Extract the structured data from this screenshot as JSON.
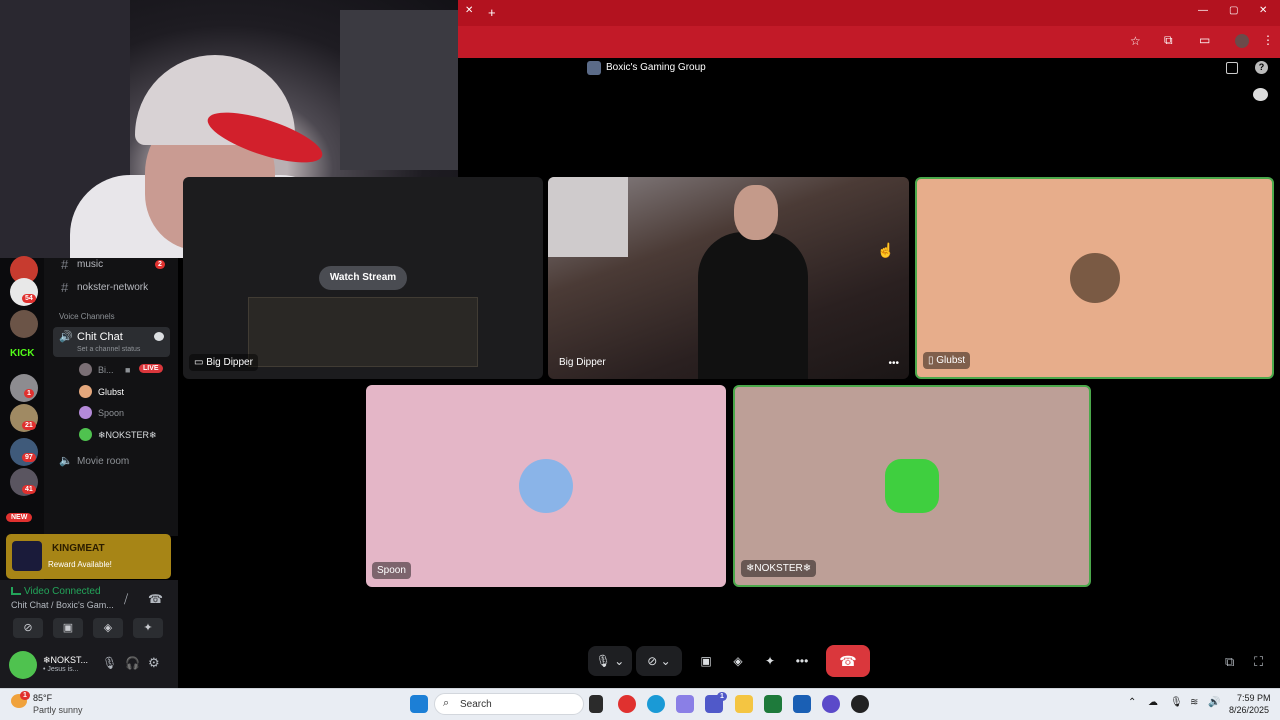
{
  "browser": {
    "new_tab_glyph": "+",
    "close_tab_glyph": "✕",
    "window_controls": [
      "—",
      "▢",
      "✕"
    ]
  },
  "discord": {
    "server_title": "Boxic's Gaming Group",
    "channels": {
      "music_label": "music",
      "music_badge": "2",
      "nokster_label": "nokster-network",
      "voice_header": "Voice Channels",
      "chit_chat_label": "Chit Chat",
      "chit_chat_status": "Set a channel status",
      "voice_users": [
        "Bi...",
        "Glubst",
        "Spoon",
        "❄NOKSTER❄"
      ],
      "live_badge": "LIVE",
      "movie_room_label": "Movie room"
    },
    "rail_badges": [
      "54",
      "1",
      "21",
      "97",
      "41"
    ],
    "rail_kick": "KICK",
    "rail_new": "NEW",
    "reward": {
      "title": "KINGMEAT",
      "subtitle": "Reward Available!"
    },
    "voice_panel": {
      "status": "Video Connected",
      "channel": "Chit Chat / Boxic's Gam...",
      "user_name": "❄NOKST...",
      "user_status": "• Jesus is..."
    },
    "tiles": {
      "stream_label": "Big Dipper",
      "watch_stream": "Watch Stream",
      "cam_label": "Big Dipper",
      "glubst_label": "Glubst",
      "spoon_label": "Spoon",
      "nokster_label": "❄NOKSTER❄",
      "more_glyph": "•••"
    }
  },
  "taskbar": {
    "weather_temp": "85°F",
    "weather_desc": "Partly sunny",
    "search_placeholder": "Search",
    "time": "7:59 PM",
    "date": "8/26/2025",
    "weather_badge": "1",
    "teams_badge": "1"
  }
}
